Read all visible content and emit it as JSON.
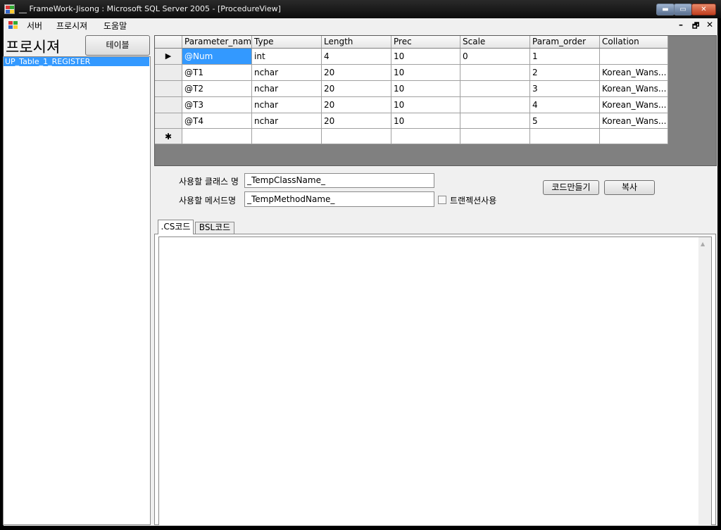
{
  "window": {
    "title": "__ FrameWork-Jisong : Microsoft SQL Server 2005 - [ProcedureView]",
    "min_label": "▬",
    "max_label": "▭",
    "close_label": "✕"
  },
  "menu": {
    "items": [
      "서버",
      "프로시져",
      "도움말"
    ],
    "mdi_min": "–",
    "mdi_restore": "🗗",
    "mdi_close": "✕"
  },
  "left": {
    "title": "프로시져",
    "table_button": "테이블",
    "procedures": [
      "UP_Table_1_REGISTER"
    ]
  },
  "grid": {
    "columns": [
      "Parameter_name",
      "Type",
      "Length",
      "Prec",
      "Scale",
      "Param_order",
      "Collation"
    ],
    "rows": [
      [
        "@Num",
        "int",
        "4",
        "10",
        "0",
        "1",
        ""
      ],
      [
        "@T1",
        "nchar",
        "20",
        "10",
        "",
        "2",
        "Korean_Wans..."
      ],
      [
        "@T2",
        "nchar",
        "20",
        "10",
        "",
        "3",
        "Korean_Wans..."
      ],
      [
        "@T3",
        "nchar",
        "20",
        "10",
        "",
        "4",
        "Korean_Wans..."
      ],
      [
        "@T4",
        "nchar",
        "20",
        "10",
        "",
        "5",
        "Korean_Wans..."
      ]
    ],
    "current_marker": "▶",
    "new_row_marker": "✱"
  },
  "form": {
    "class_label": "사용할 클래스 명",
    "class_value": "_TempClassName_",
    "method_label": "사용할 메서드명",
    "method_value": "_TempMethodName_",
    "transaction_label": "트랜젝션사용",
    "transaction_checked": false,
    "generate_button": "코드만들기",
    "copy_button": "복사"
  },
  "tabs": [
    {
      "label": ".CS코드",
      "active": true
    },
    {
      "label": "BSL코드",
      "active": false
    }
  ],
  "code": {
    "content": "",
    "scroll_up": "▲"
  },
  "colors": {
    "selection": "#3399ff",
    "frame": "#000000",
    "panel": "#f0f0f0"
  }
}
